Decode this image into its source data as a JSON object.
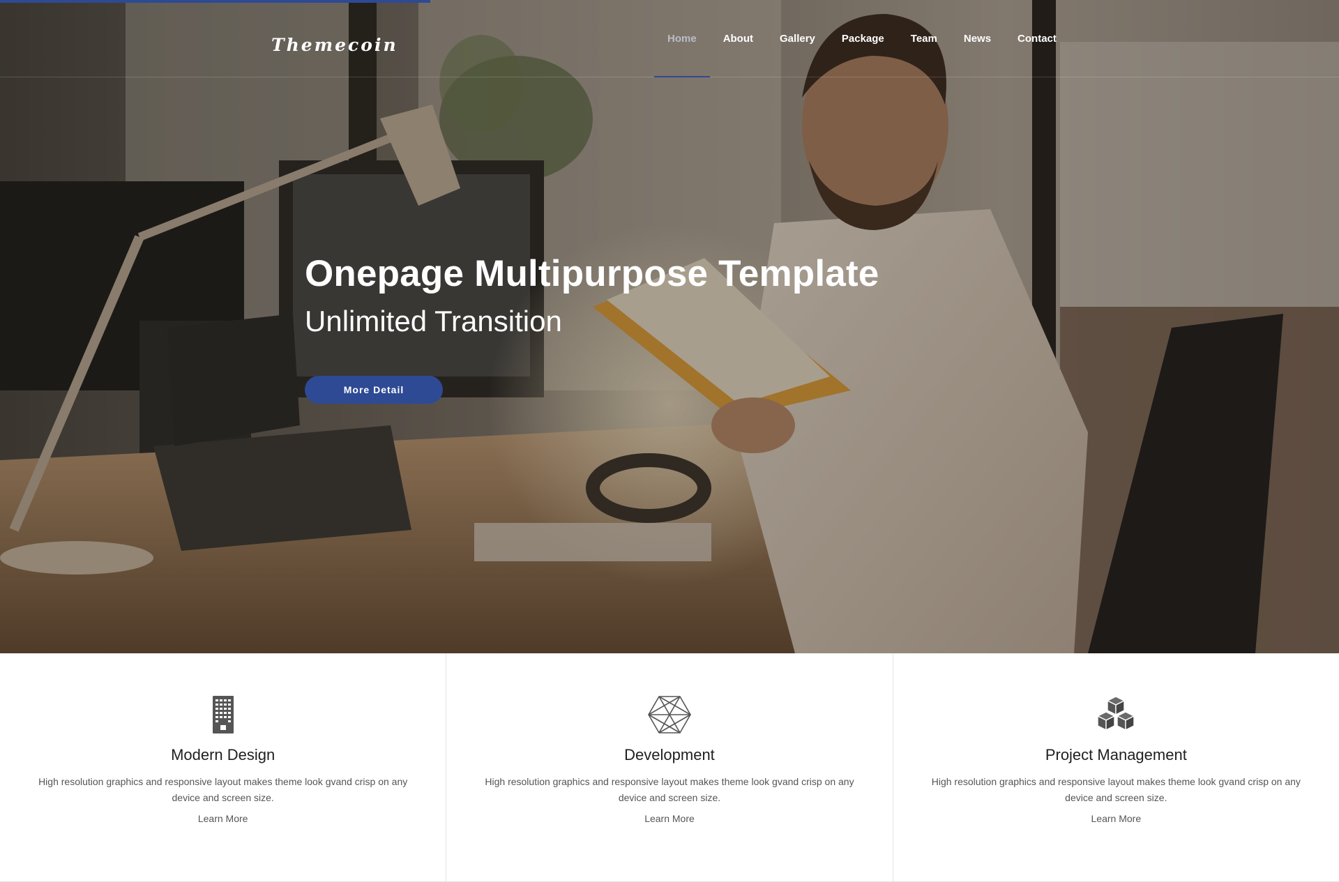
{
  "brand": {
    "logo_text": "Themecoin",
    "accent_color": "#2e4a94"
  },
  "nav": {
    "items": [
      {
        "label": "Home",
        "active": true
      },
      {
        "label": "About"
      },
      {
        "label": "Gallery"
      },
      {
        "label": "Package"
      },
      {
        "label": "Team"
      },
      {
        "label": "News"
      },
      {
        "label": "Contact"
      }
    ]
  },
  "hero": {
    "title": "Onepage Multipurpose Template",
    "subtitle": "Unlimited Transition",
    "button_label": "More Detail"
  },
  "features": [
    {
      "icon": "building-icon",
      "title": "Modern Design",
      "text": "High resolution graphics and responsive layout makes theme look gvand crisp on any device and screen size.",
      "link": "Learn More"
    },
    {
      "icon": "hexagon-mesh-icon",
      "title": "Development",
      "text": "High resolution graphics and responsive layout makes theme look gvand crisp on any device and screen size.",
      "link": "Learn More"
    },
    {
      "icon": "cubes-icon",
      "title": "Project Management",
      "text": "High resolution graphics and responsive layout makes theme look gvand crisp on any device and screen size.",
      "link": "Learn More"
    }
  ]
}
